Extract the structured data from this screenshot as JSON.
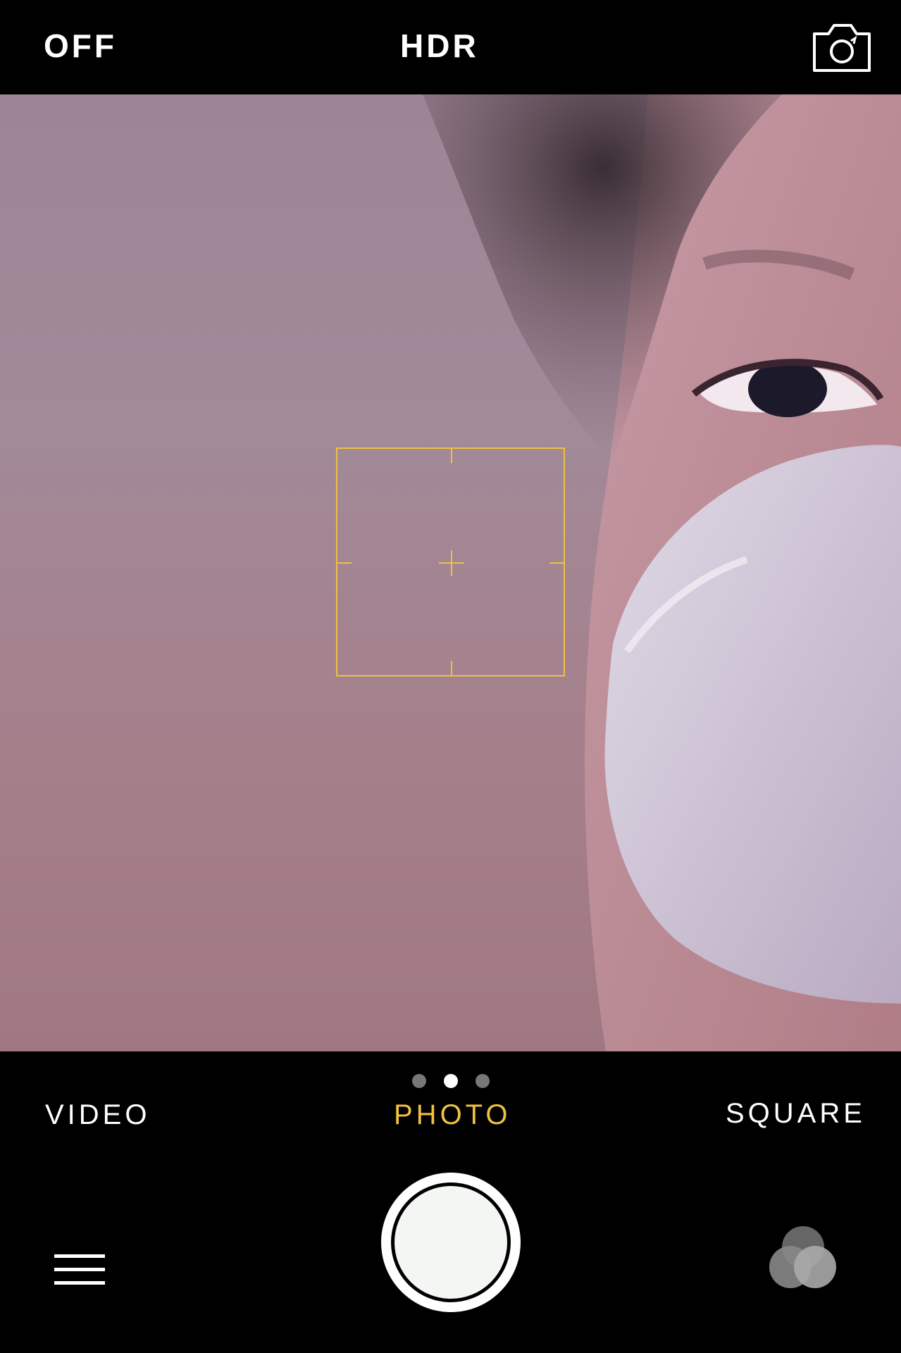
{
  "topbar": {
    "flash_label": "OFF",
    "hdr_label": "HDR",
    "flip_icon": "camera-flip-icon"
  },
  "viewfinder": {
    "focus_color": "#f0c040"
  },
  "modes": {
    "video": "VIDEO",
    "photo": "PHOTO",
    "square": "SQUARE",
    "active": "PHOTO",
    "active_color": "#f0c040"
  },
  "page_indicator": {
    "count": 3,
    "active_index": 1
  },
  "controls": {
    "shutter_icon": "shutter-button",
    "menu_icon": "hamburger-menu-icon",
    "filters_icon": "filters-icon"
  }
}
